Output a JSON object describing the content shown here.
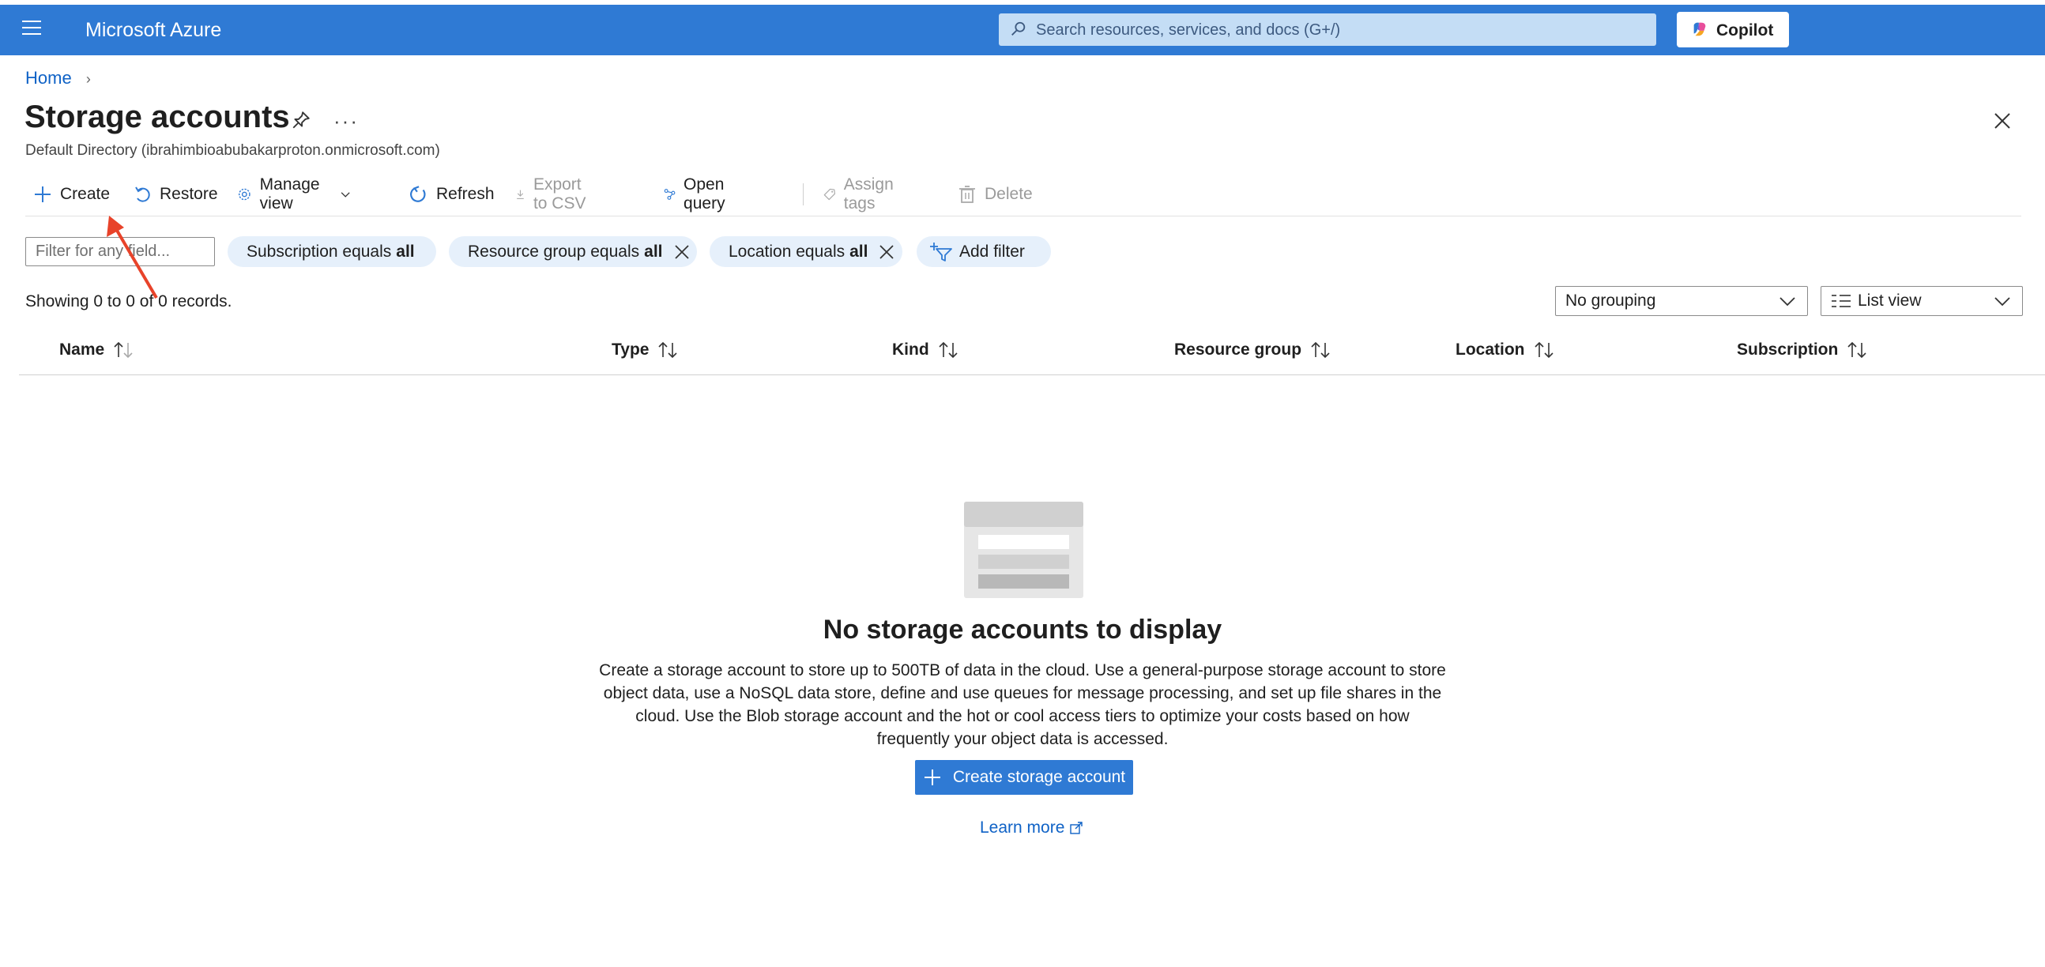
{
  "topbar": {
    "brand": "Microsoft Azure",
    "search_placeholder": "Search resources, services, and docs (G+/)",
    "copilot_label": "Copilot"
  },
  "breadcrumb": {
    "home": "Home"
  },
  "page": {
    "title": "Storage accounts",
    "subtitle": "Default Directory (ibrahimbioabubakarproton.onmicrosoft.com)"
  },
  "toolbar": {
    "create": "Create",
    "restore": "Restore",
    "manage_view": "Manage view",
    "refresh": "Refresh",
    "export_csv": "Export to CSV",
    "open_query": "Open query",
    "assign_tags": "Assign tags",
    "delete": "Delete"
  },
  "filters": {
    "placeholder": "Filter for any field...",
    "subscription_prefix": "Subscription equals",
    "subscription_value": "all",
    "resource_group_prefix": "Resource group equals",
    "resource_group_value": "all",
    "location_prefix": "Location equals",
    "location_value": "all",
    "add_filter": "Add filter"
  },
  "records": "Showing 0 to 0 of 0 records.",
  "view": {
    "grouping": "No grouping",
    "list_view": "List view"
  },
  "columns": [
    "Name",
    "Type",
    "Kind",
    "Resource group",
    "Location",
    "Subscription"
  ],
  "empty": {
    "title": "No storage accounts to display",
    "description": "Create a storage account to store up to 500TB of data in the cloud. Use a general-purpose storage account to store object data, use a NoSQL data store, define and use queues for message processing, and set up file shares in the cloud. Use the Blob storage account and the hot or cool access tiers to optimize your costs based on how frequently your object data is accessed.",
    "create_button": "Create storage account",
    "learn_more": "Learn more"
  },
  "colors": {
    "azure_blue": "#2f7ad4",
    "link": "#0f62c6",
    "annotation": "#e8432a"
  }
}
